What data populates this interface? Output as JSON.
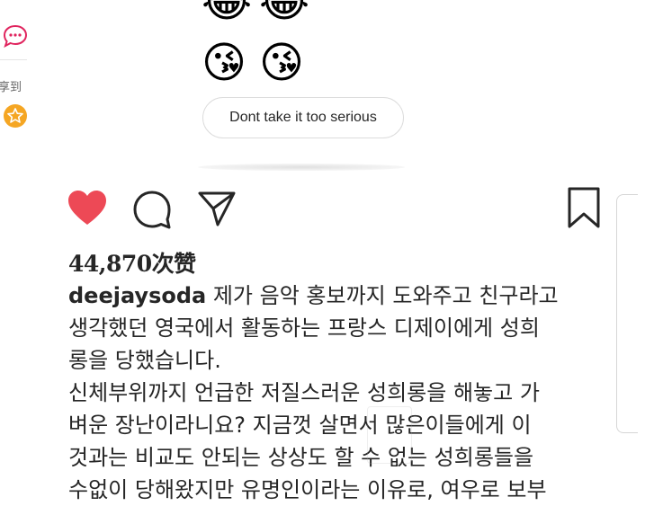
{
  "sidebar": {
    "share_label": "享到"
  },
  "story": {
    "emoji_rows": [
      [
        "😂",
        "😂"
      ],
      [
        "😘",
        "😘"
      ]
    ],
    "reply_text": "Dont take it too serious"
  },
  "post": {
    "likes": "44,870次赞",
    "username": "deejaysoda",
    "caption_lines": [
      " 제가 음악 홍보까지 도와주고 친구라고",
      "생각했던 영국에서 활동하는 프랑스 디제이에게 성희",
      "롱을 당했습니다.",
      "신체부위까지 언급한 저질스러운 성희롱을 해놓고 가",
      "벼운 장난이라니요? 지금껏 살면서 많은이들에게 이",
      "것과는 비교도 안되는 상상도 할 수 없는 성희롱들을",
      "수없이 당해왔지만 유명인이라는 이유로, 여우로 보부"
    ]
  },
  "colors": {
    "like_red": "#ed4956",
    "text": "#262626",
    "accent_red": "#e0245e",
    "star_orange": "#f5a623"
  },
  "icons": [
    "comment-bubble-icon",
    "star-icon",
    "heart-icon",
    "comment-icon",
    "share-icon",
    "bookmark-icon"
  ]
}
